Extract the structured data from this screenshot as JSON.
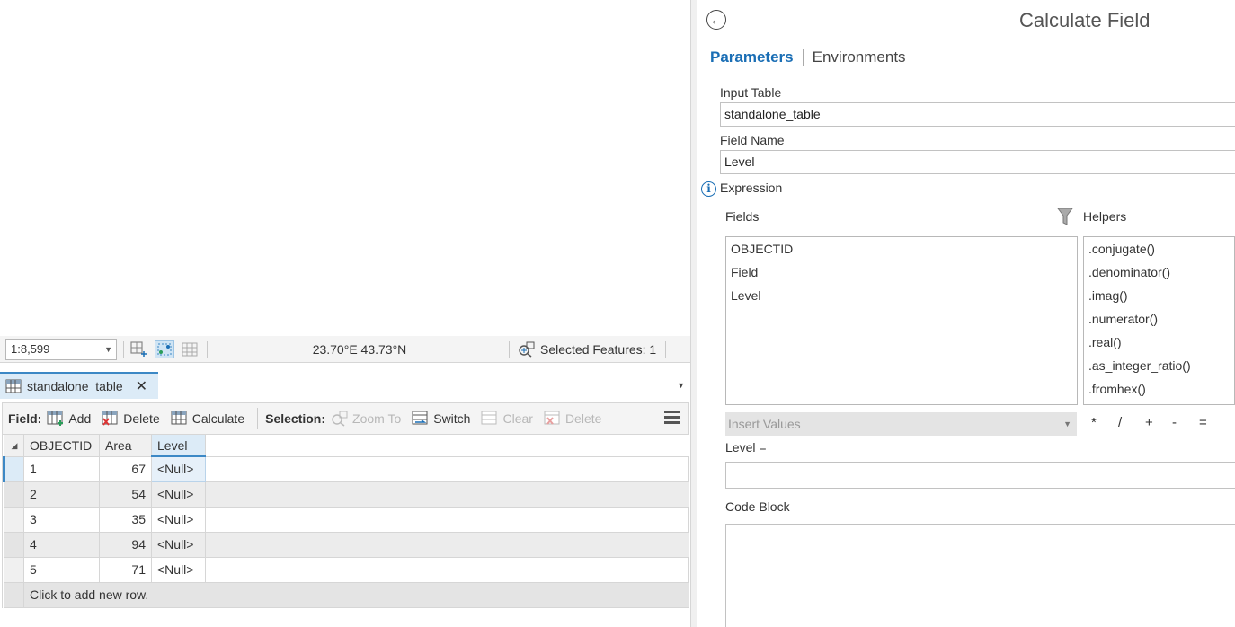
{
  "map_status": {
    "scale_value": "1:8,599",
    "coordinates": "23.70°E 43.73°N",
    "selected_features": "Selected Features: 1"
  },
  "table_view": {
    "tab_title": "standalone_table",
    "toolbar": {
      "field_label": "Field:",
      "add_label": "Add",
      "delete_label": "Delete",
      "calculate_label": "Calculate",
      "selection_label": "Selection:",
      "zoom_to_label": "Zoom To",
      "switch_label": "Switch",
      "clear_label": "Clear",
      "sel_delete_label": "Delete"
    },
    "columns": [
      "OBJECTID",
      "Area",
      "Level"
    ],
    "rows": [
      {
        "objectid": "1",
        "area": "67",
        "level": "<Null>"
      },
      {
        "objectid": "2",
        "area": "54",
        "level": "<Null>"
      },
      {
        "objectid": "3",
        "area": "35",
        "level": "<Null>"
      },
      {
        "objectid": "4",
        "area": "94",
        "level": "<Null>"
      },
      {
        "objectid": "5",
        "area": "71",
        "level": "<Null>"
      }
    ],
    "add_row_text": "Click to add new row."
  },
  "geoprocessing": {
    "title": "Calculate Field",
    "tabs": {
      "parameters": "Parameters",
      "environments": "Environments"
    },
    "input_table_label": "Input Table",
    "input_table_value": "standalone_table",
    "field_name_label": "Field Name",
    "field_name_value": "Level",
    "expression_label": "Expression",
    "fields_label": "Fields",
    "helpers_label": "Helpers",
    "fields": [
      "OBJECTID",
      "Field",
      "Level"
    ],
    "helpers": [
      ".conjugate()",
      ".denominator()",
      ".imag()",
      ".numerator()",
      ".real()",
      ".as_integer_ratio()",
      ".fromhex()"
    ],
    "insert_values_placeholder": "Insert Values",
    "operators": [
      "*",
      "/",
      "+",
      "-",
      "="
    ],
    "expression_target": "Level =",
    "code_block_label": "Code Block"
  },
  "colors": {
    "accent": "#3c88c5",
    "link": "#1a6eb5",
    "tab_bg": "#dcebf7"
  }
}
